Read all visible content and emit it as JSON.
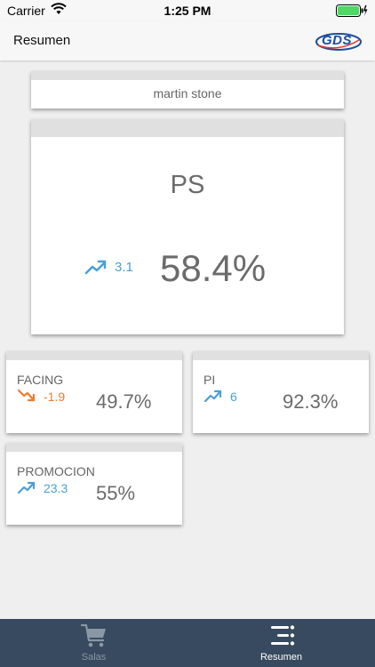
{
  "status_bar": {
    "carrier": "Carrier",
    "time": "1:25 PM"
  },
  "nav": {
    "title": "Resumen",
    "logo_text": "GDS"
  },
  "user": {
    "name": "martin stone"
  },
  "main_metric": {
    "name": "PS",
    "trend": "up",
    "trend_value": "3.1",
    "percent": "58.4%"
  },
  "metrics": [
    {
      "name": "FACING",
      "trend": "down",
      "trend_value": "-1.9",
      "percent": "49.7%"
    },
    {
      "name": "PI",
      "trend": "up",
      "trend_value": "6",
      "percent": "92.3%"
    },
    {
      "name": "PROMOCION",
      "trend": "up",
      "trend_value": "23.3",
      "percent": "55%"
    }
  ],
  "tabs": [
    {
      "label": "Salas",
      "icon": "cart-icon",
      "active": false
    },
    {
      "label": "Resumen",
      "icon": "list-icon",
      "active": true
    }
  ],
  "colors": {
    "trend_up": "#4a9fd8",
    "trend_down": "#f07b2e",
    "tab_bar": "#374a5f",
    "battery": "#4cd964"
  }
}
